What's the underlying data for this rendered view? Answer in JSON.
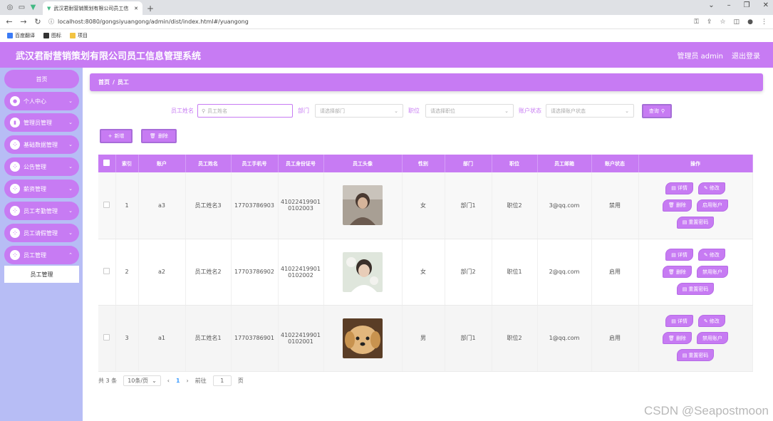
{
  "browser": {
    "tab_title": "武汉君耐营销策划有限公司员工信",
    "url": "localhost:8080/gongsiyuangong/admin/dist/index.html#/yuangong",
    "bookmarks": [
      "百度翻译",
      "图标",
      "项目"
    ]
  },
  "header": {
    "title": "武汉君耐营销策划有限公司员工信息管理系统",
    "user": "管理员 admin",
    "logout": "退出登录"
  },
  "sidebar": {
    "home": "首页",
    "items": [
      {
        "label": "个人中心"
      },
      {
        "label": "管理员管理"
      },
      {
        "label": "基础数据管理"
      },
      {
        "label": "公告管理"
      },
      {
        "label": "薪资管理"
      },
      {
        "label": "员工考勤管理"
      },
      {
        "label": "员工请假管理"
      },
      {
        "label": "员工管理"
      }
    ],
    "sub_active": "员工管理"
  },
  "breadcrumb": {
    "home": "首页",
    "sep": "/",
    "current": "员工"
  },
  "search": {
    "name_label": "员工姓名",
    "name_placeholder": "员工姓名",
    "dept_label": "部门",
    "dept_placeholder": "请选择部门",
    "pos_label": "职位",
    "pos_placeholder": "请选择职位",
    "status_label": "账户状态",
    "status_placeholder": "请选择账户状态",
    "query_btn": "查询"
  },
  "actions": {
    "add": "新增",
    "delete": "删除"
  },
  "table": {
    "headers": [
      "索引",
      "账户",
      "员工姓名",
      "员工手机号",
      "员工身份证号",
      "员工头像",
      "性别",
      "部门",
      "职位",
      "员工邮箱",
      "账户状态",
      "操作"
    ],
    "rows": [
      {
        "index": "1",
        "account": "a3",
        "name": "员工姓名3",
        "phone": "17703786903",
        "id_line1": "41022419901",
        "id_line2": "0102003",
        "gender": "女",
        "dept": "部门1",
        "position": "职位2",
        "email": "3@qq.com",
        "status": "禁用",
        "toggle": "启用账户"
      },
      {
        "index": "2",
        "account": "a2",
        "name": "员工姓名2",
        "phone": "17703786902",
        "id_line1": "41022419901",
        "id_line2": "0102002",
        "gender": "女",
        "dept": "部门2",
        "position": "职位1",
        "email": "2@qq.com",
        "status": "启用",
        "toggle": "禁用账户"
      },
      {
        "index": "3",
        "account": "a1",
        "name": "员工姓名1",
        "phone": "17703786901",
        "id_line1": "41022419901",
        "id_line2": "0102001",
        "gender": "男",
        "dept": "部门1",
        "position": "职位2",
        "email": "1@qq.com",
        "status": "启用",
        "toggle": "禁用账户"
      }
    ],
    "op_detail": "详情",
    "op_edit": "修改",
    "op_delete": "删除",
    "op_reset": "重置密码"
  },
  "pager": {
    "total": "共 3 条",
    "size": "10条/页",
    "page": "1",
    "goto": "前往",
    "goto_value": "1",
    "page_unit": "页"
  },
  "watermark": "CSDN @Seapostmoon",
  "colors": {
    "accent": "#c77bf3",
    "sidebar_bg": "#b7bdf5"
  }
}
